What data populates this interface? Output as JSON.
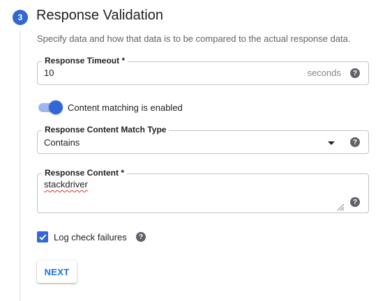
{
  "step": {
    "number": "3",
    "title": "Response Validation"
  },
  "description": "Specify data and how that data is to be compared to the actual response data.",
  "timeout": {
    "label": "Response Timeout *",
    "value": "10",
    "suffix": "seconds",
    "help_icon": "help-icon"
  },
  "content_matching": {
    "label": "Content matching is enabled",
    "enabled": true
  },
  "match_type": {
    "label": "Response Content Match Type",
    "value": "Contains",
    "icon": "dropdown-caret-icon",
    "help_icon": "help-icon"
  },
  "response_content": {
    "label": "Response Content *",
    "value": "stackdriver",
    "help_icon": "help-icon"
  },
  "log_failures": {
    "label": "Log check failures",
    "checked": true,
    "help_icon": "help-icon"
  },
  "next_button": {
    "label": "NEXT"
  },
  "colors": {
    "accent": "#3367d6",
    "button_text": "#1a73e8",
    "border": "#c4c4c4",
    "muted": "#5f6368"
  }
}
